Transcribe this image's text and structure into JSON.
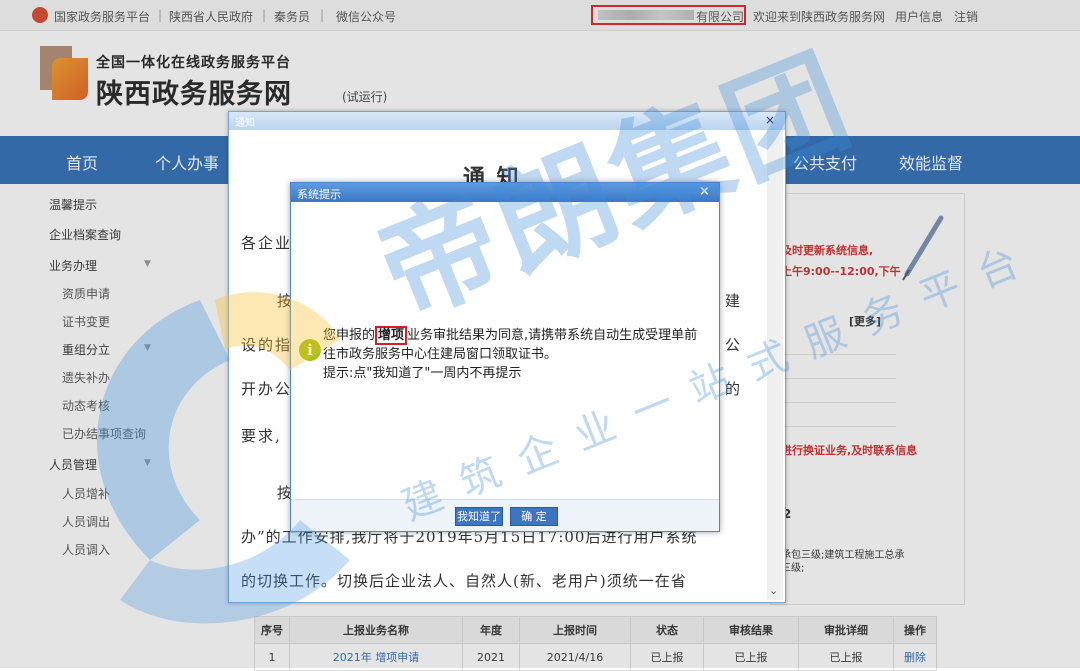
{
  "topbar": {
    "links": [
      "国家政务服务平台",
      "陕西省人民政府",
      "秦务员",
      "微信公众号"
    ],
    "company_suffix": "有限公司",
    "welcome": "欢迎来到陕西政务服务网",
    "user_info": "用户信息",
    "logout": "注销"
  },
  "header": {
    "subtitle": "全国一体化在线政务服务平台",
    "title": "陕西政务服务网",
    "beta": "(试运行)"
  },
  "nav": {
    "items": [
      "首页",
      "个人办事",
      "公共支付",
      "效能监督"
    ]
  },
  "left_menu": [
    {
      "label": "温馨提示",
      "level": 1
    },
    {
      "label": "企业档案查询",
      "level": 1
    },
    {
      "label": "业务办理",
      "level": 1,
      "caret": "▼"
    },
    {
      "label": "资质申请",
      "level": 2
    },
    {
      "label": "证书变更",
      "level": 2
    },
    {
      "label": "重组分立",
      "level": 2,
      "caret": "▼"
    },
    {
      "label": "遗失补办",
      "level": 2
    },
    {
      "label": "动态考核",
      "level": 2
    },
    {
      "label": "已办结事项查询",
      "level": 2
    },
    {
      "label": "人员管理",
      "level": 1,
      "caret": "▼"
    },
    {
      "label": "人员增补",
      "level": 2
    },
    {
      "label": "人员调出",
      "level": 2
    },
    {
      "label": "人员调入",
      "level": 2
    }
  ],
  "right_panel": {
    "red_line1": "及时更新系统信息,",
    "red_line2": "上午9:00--12:00,下午",
    "more": "[更多]",
    "red_line3": "进行换证业务,及时联系信息",
    "qual_line1": "业承包三级;建筑工程施工总承",
    "qual_line2": "包三级;",
    "num": "2"
  },
  "table": {
    "headers": [
      "序号",
      "上报业务名称",
      "年度",
      "上报时间",
      "状态",
      "审核结果",
      "审批详细",
      "操作"
    ],
    "rows": [
      [
        "1",
        "2021年 增项申请",
        "2021",
        "2021/4/16",
        "已上报",
        "已上报",
        "已上报",
        "删除"
      ]
    ]
  },
  "notice": {
    "window_title": "通知",
    "heading": "通  知",
    "salutation": "各企业",
    "lines": [
      {
        "left": "按",
        "right": "建"
      },
      {
        "left": "设的指",
        "right": "公"
      },
      {
        "left": "开办公",
        "right": "的"
      },
      {
        "left": "要求,",
        "right": ""
      },
      {
        "left": "按",
        "right": ""
      }
    ],
    "line_partial": "办”的工作安排,我厅将于2019年5月15日17:00后进行用户系统",
    "line_last": "的切换工作。切换后企业法人、自然人(新、老用户)须统一在省"
  },
  "sys_dialog": {
    "title": "系统提示",
    "close": "×",
    "msg_pre": "您申报的",
    "msg_highlight": "增项",
    "msg_post": "业务审批结果为同意,请携带系统自动生成受理单前",
    "msg_line2": "往市政务服务中心住建局窗口领取证书。",
    "msg_line3": "提示:点\"我知道了\"一周内不再提示",
    "btn_know": "我知道了",
    "btn_ok": "确 定"
  },
  "watermark": {
    "brand": "帝朗集团",
    "slogan": "建筑企业一站式服务平台"
  },
  "colors": {
    "nav": "#2e6db7",
    "accent_red": "#d41f27",
    "info_green": "#9bc31b"
  }
}
